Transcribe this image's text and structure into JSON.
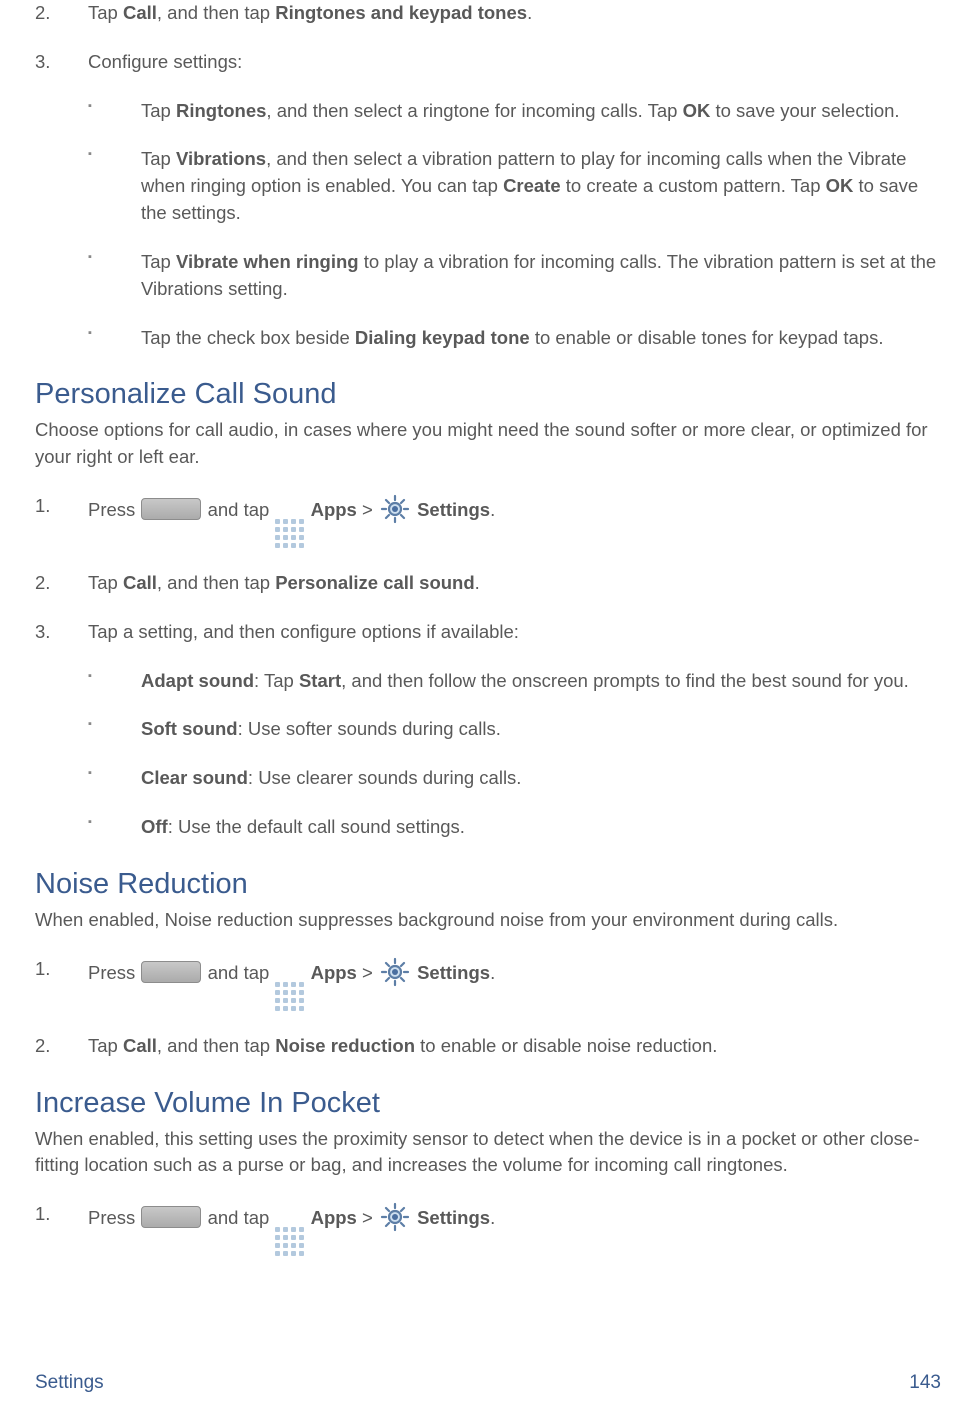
{
  "top": {
    "step2_pre": "Tap ",
    "step2_b1": "Call",
    "step2_mid": ", and then tap ",
    "step2_b2": "Ringtones and keypad tones",
    "step2_post": ".",
    "step3": "Configure settings:",
    "bullets": [
      {
        "pre": "Tap ",
        "b1": "Ringtones",
        "mid": ", and then select a ringtone for incoming calls. Tap ",
        "b2": "OK",
        "post": " to save your selection."
      },
      {
        "pre": "Tap ",
        "b1": "Vibrations",
        "mid": ", and then select a vibration pattern to play for incoming calls when the Vibrate when ringing option is enabled. You can tap ",
        "b2": "Create",
        "mid2": " to create a custom pattern. Tap ",
        "b3": "OK",
        "post": " to save the settings."
      },
      {
        "pre": "Tap ",
        "b1": "Vibrate when ringing",
        "post": " to play a vibration for incoming calls. The vibration pattern is set at the Vibrations setting."
      },
      {
        "pre": "Tap the check box beside ",
        "b1": "Dialing keypad tone",
        "post": " to enable or disable tones for keypad taps."
      }
    ]
  },
  "personalize": {
    "heading": "Personalize Call Sound",
    "intro": "Choose options for call audio, in cases where you might need the sound softer or more clear, or optimized for your right or left ear.",
    "step1_pre": "Press ",
    "step1_andtap": " and tap ",
    "apps": "Apps",
    "gt": " > ",
    "settings": "Settings",
    "period": ".",
    "step2_pre": "Tap ",
    "step2_b1": "Call",
    "step2_mid": ", and then tap ",
    "step2_b2": "Personalize call sound",
    "step2_post": ".",
    "step3": "Tap a setting, and then configure options if available:",
    "bullets": [
      {
        "b1": "Adapt sound",
        "mid": ": Tap ",
        "b2": "Start",
        "post": ", and then follow the onscreen prompts to find the best sound for you."
      },
      {
        "b1": "Soft sound",
        "post": ": Use softer sounds during calls."
      },
      {
        "b1": "Clear sound",
        "post": ": Use clearer sounds during calls."
      },
      {
        "b1": "Off",
        "post": ": Use the default call sound settings."
      }
    ]
  },
  "noise": {
    "heading": "Noise Reduction",
    "intro": "When enabled, Noise reduction suppresses background noise from your environment during calls.",
    "step1_pre": "Press ",
    "step1_andtap": " and tap ",
    "apps": "Apps",
    "gt": " > ",
    "settings": "Settings",
    "period": ".",
    "step2_pre": "Tap ",
    "step2_b1": "Call",
    "step2_mid": ", and then tap ",
    "step2_b2": "Noise reduction",
    "step2_post": " to enable or disable noise reduction."
  },
  "pocket": {
    "heading": "Increase Volume In Pocket",
    "intro": "When enabled, this setting uses the proximity sensor to detect when the device is in a pocket or other close-fitting location such as a purse or bag, and increases the volume for incoming call ringtones.",
    "step1_pre": "Press ",
    "step1_andtap": " and tap ",
    "apps": "Apps",
    "gt": " > ",
    "settings": "Settings",
    "period": "."
  },
  "footer": {
    "left": "Settings",
    "right": "143"
  }
}
